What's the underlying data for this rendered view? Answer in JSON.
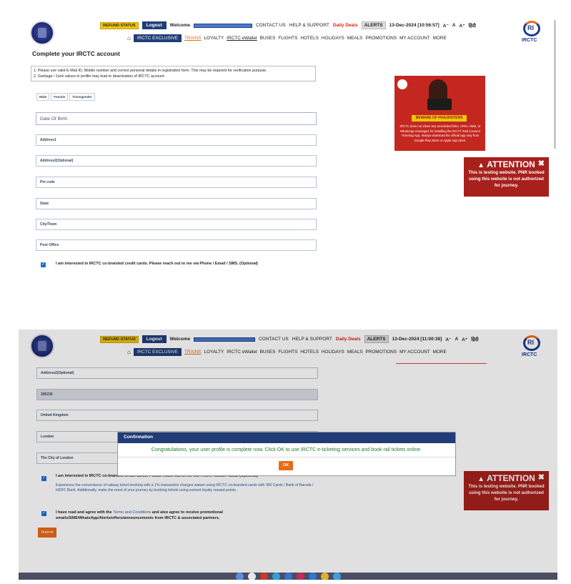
{
  "header": {
    "refund_status": "REFUND STATUS",
    "logout": "Logout",
    "welcome": "Welcome",
    "contact_us": "CONTACT US",
    "help_support": "HELP & SUPPORT",
    "daily_deals": "Daily Deals",
    "alerts": "ALERTS",
    "font_small": "A⁻",
    "font_normal": "A",
    "font_large": "A⁺",
    "hindi": "हिंदी",
    "brand_right": "IRCTC"
  },
  "nav": {
    "home_icon": "home-icon",
    "exclusive": "IRCTC EXCLUSIVE",
    "items": [
      "TRAINS",
      "LOYALTY",
      "IRCTC eWallet",
      "BUSES",
      "FLIGHTS",
      "HOTELS",
      "HOLIDAYS",
      "MEALS",
      "PROMOTIONS",
      "MY ACCOUNT",
      "MORE"
    ]
  },
  "shot1": {
    "datetime": "13-Dec-2024 [10:56:57]",
    "page_title": "Complete your IRCTC account",
    "notice": [
      "1. Please use valid E-Mail ID, Mobile number and correct personal details in registration form. This may be required for verification purpose.",
      "2. Garbage / Junk values in profile may lead to deactivation of IRCTC account."
    ],
    "gender": [
      "Male",
      "Female",
      "Transgender"
    ],
    "fields": {
      "dob": "Date Of Birth",
      "address1": "Address1",
      "address2": "Address2(Optional)",
      "pincode": "Pin code",
      "state": "State",
      "city": "City/Town",
      "post_office": "Post Office"
    },
    "checkbox_partial": "I am interested in IRCTC co-branded credit cards. Please reach out to me via Phone / Email / SMS. (Optional)"
  },
  "ad": {
    "badge": "BEWARE OF FRAUDSTERS",
    "text": "IRCTC does not share any unsolicited links, APKs, SMS, or WhatsApp messages for installing the IRCTC Rail Connect Ticketing App. Always download the official app only from Google Play Store or Apple App Store."
  },
  "attention": {
    "title": "ATTENTION",
    "body": "This is testing website. PNR booked using this website is not authorized for journey."
  },
  "shot2": {
    "datetime": "13-Dec-2024 [11:00:38]",
    "fields": {
      "address2": "Address2(Optional)",
      "pincode": "396230",
      "state": "United Kingdom",
      "city": "London",
      "post_office": "The City of London"
    },
    "checkbox1_label": "I am interested in IRCTC co-branded credit cards. Please reach out to me via Phone / Email / SMS. (Optional)",
    "checkbox1_desc": "Experience the convenience of railway ticket booking with a 1% transaction charges waiver using IRCTC co-branded cards with SBI Cards / Bank of Baroda / HDFC Bank. Additionally, make the most of your journey by booking tickets using earned loyalty reward points.",
    "checkbox2_pre": "I have read and agree with the ",
    "checkbox2_link": "Terms and Conditions",
    "checkbox2_post": " and also agree to receive promotional emails/SMS/WhatsApp/Alerts/offers/announcements from IRCTC & associated partners.",
    "submit": "Submit",
    "modal_title": "Confirmation",
    "modal_message": "Congratulations, your user profile is complete now. Click OK to use IRCTC e-ticketing services and book rail tickets online.",
    "modal_ok": "OK"
  },
  "colors": {
    "brand_navy": "#213d77",
    "accent_orange": "#e86a1a",
    "attention_red": "#a7201c",
    "success_green": "#1f7a2c"
  }
}
